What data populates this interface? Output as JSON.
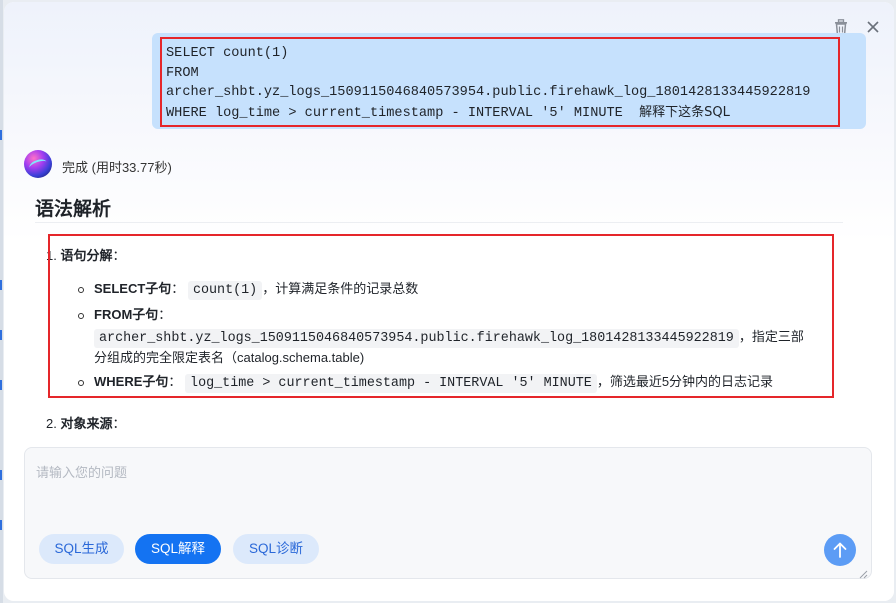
{
  "user_message": {
    "lines": [
      "SELECT count(1)",
      "FROM",
      "archer_shbt.yz_logs_1509115046840573954.public.firehawk_log_1801428133445922819",
      "WHERE log_time > current_timestamp - INTERVAL '5' MINUTE  "
    ],
    "suffix": "解释下这条SQL"
  },
  "assistant": {
    "status": "完成 (用时33.77秒)",
    "heading": "语法解析",
    "list": [
      {
        "num": "1.",
        "title": "语句分解",
        "colon": "：",
        "items": [
          {
            "label": "SELECT子句",
            "sep": "：",
            "code": "count(1)",
            "desc": "，计算满足条件的记录总数"
          },
          {
            "label": "FROM子句",
            "sep": "：",
            "code": "archer_shbt.yz_logs_1509115046840573954.public.firehawk_log_1801428133445922819",
            "desc": "，指定三部",
            "desc2": "分组成的完全限定表名（catalog.schema.table)"
          },
          {
            "label": "WHERE子句",
            "sep": "：",
            "code": "log_time > current_timestamp - INTERVAL '5' MINUTE",
            "desc": "，筛选最近5分钟内的日志记录"
          }
        ]
      },
      {
        "num": "2.",
        "title": "对象来源",
        "colon": "："
      }
    ]
  },
  "input": {
    "placeholder": "请输入您的问题",
    "modes": [
      "SQL生成",
      "SQL解释",
      "SQL诊断"
    ],
    "active_mode": "SQL解释"
  },
  "icons": [
    "trash-icon",
    "close-icon",
    "assistant-avatar",
    "send-arrow-icon",
    "resize-handle-icon"
  ],
  "colors": {
    "accent": "#1473f2",
    "user_bubble": "#c6e1fd",
    "highlight_border": "#e5262a",
    "send_button": "#5c9cf5"
  }
}
